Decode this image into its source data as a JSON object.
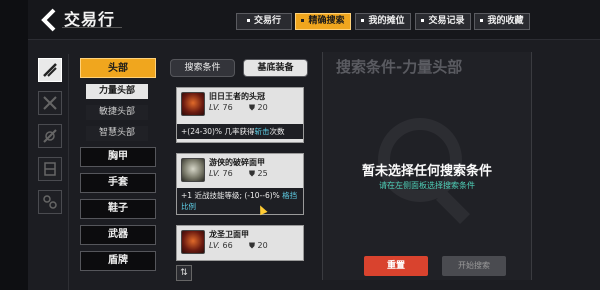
{
  "header": {
    "title": "交易行",
    "tabs": [
      {
        "label": "交易行",
        "active": false
      },
      {
        "label": "精确搜索",
        "active": true
      },
      {
        "label": "我的摊位",
        "active": false
      },
      {
        "label": "交易记录",
        "active": false
      },
      {
        "label": "我的收藏",
        "active": false
      }
    ]
  },
  "sidebar": {
    "icons": [
      "sword-icon",
      "armor-icon",
      "shield-icon",
      "equipment-icon"
    ]
  },
  "categories": {
    "head_label": "头部",
    "sub_items": [
      "力量头部",
      "敏捷头部",
      "智慧头部"
    ],
    "items": [
      "胸甲",
      "手套",
      "鞋子",
      "武器",
      "盾牌"
    ]
  },
  "middle": {
    "tab_search": "搜索条件",
    "tab_base": "基底装备",
    "cards": [
      {
        "name": "旧日王者的头冠",
        "lv_label": "LV.",
        "lv": "76",
        "defense": "20",
        "desc_pre": "+(24-30)% 几率获得",
        "desc_hl": "斩击",
        "desc_post": "次数"
      },
      {
        "name": "游侠的破碎面甲",
        "lv_label": "LV.",
        "lv": "76",
        "defense": "25",
        "desc_pre": "+1 近战技能等级; (-10--6)% ",
        "desc_hl": "格挡比例",
        "desc_post": ""
      },
      {
        "name": "龙圣卫面甲",
        "lv_label": "LV.",
        "lv": "66",
        "defense": "20",
        "desc_pre": "",
        "desc_hl": "",
        "desc_post": ""
      }
    ]
  },
  "right": {
    "title": "搜索条件-力量头部",
    "main_text": "暂未选择任何搜索条件",
    "sub_text": "请在左侧面板选择搜索条件",
    "reset_label": "重置",
    "search_label": "开始搜索"
  },
  "colors": {
    "accent": "#f0a61e",
    "highlight": "#5fd0e8",
    "reset": "#d9432e"
  }
}
